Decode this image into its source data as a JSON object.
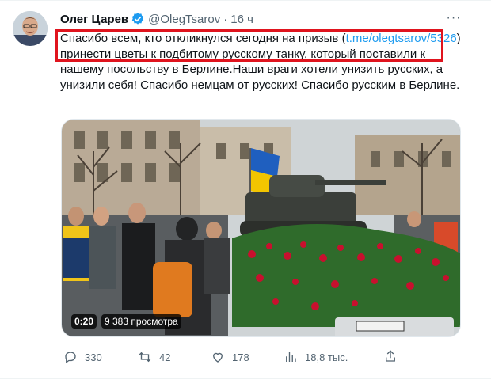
{
  "tweet": {
    "author_name": "Олег Царев",
    "handle": "@OlegTsarov",
    "separator": "·",
    "time": "16 ч",
    "text_before_link": "Спасибо всем, кто откликнулся сегодня на призыв (",
    "link_text": "t.me/olegtsarov/5326",
    "text_after_link": ") принести цветы к подбитому русскому танку, который поставили к нашему посольству в Берлине.Наши враги хотели унизить русских, а унизили себя! Спасибо немцам от русских! Спасибо русским в Берлине.",
    "more_label": "···"
  },
  "media": {
    "duration": "0:20",
    "views": "9 383 просмотра",
    "scene_colors": {
      "sky": "#cfd4d6",
      "building": "#b9aa96",
      "flag_blue": "#1f5fbf",
      "flag_yellow": "#f2c500",
      "tank": "#3b3f3a",
      "roses": "#c8102e",
      "leaves": "#2f6b2b"
    }
  },
  "actions": {
    "replies": "330",
    "retweets": "42",
    "likes": "178",
    "views": "18,8 тыс."
  },
  "icons": {
    "reply": "reply-icon",
    "retweet": "retweet-icon",
    "like": "heart-icon",
    "views": "analytics-icon",
    "share": "share-icon",
    "verified": "verified-badge-icon",
    "more": "more-icon"
  },
  "highlight_color": "#e0141e",
  "link_color": "#1d9bf0"
}
